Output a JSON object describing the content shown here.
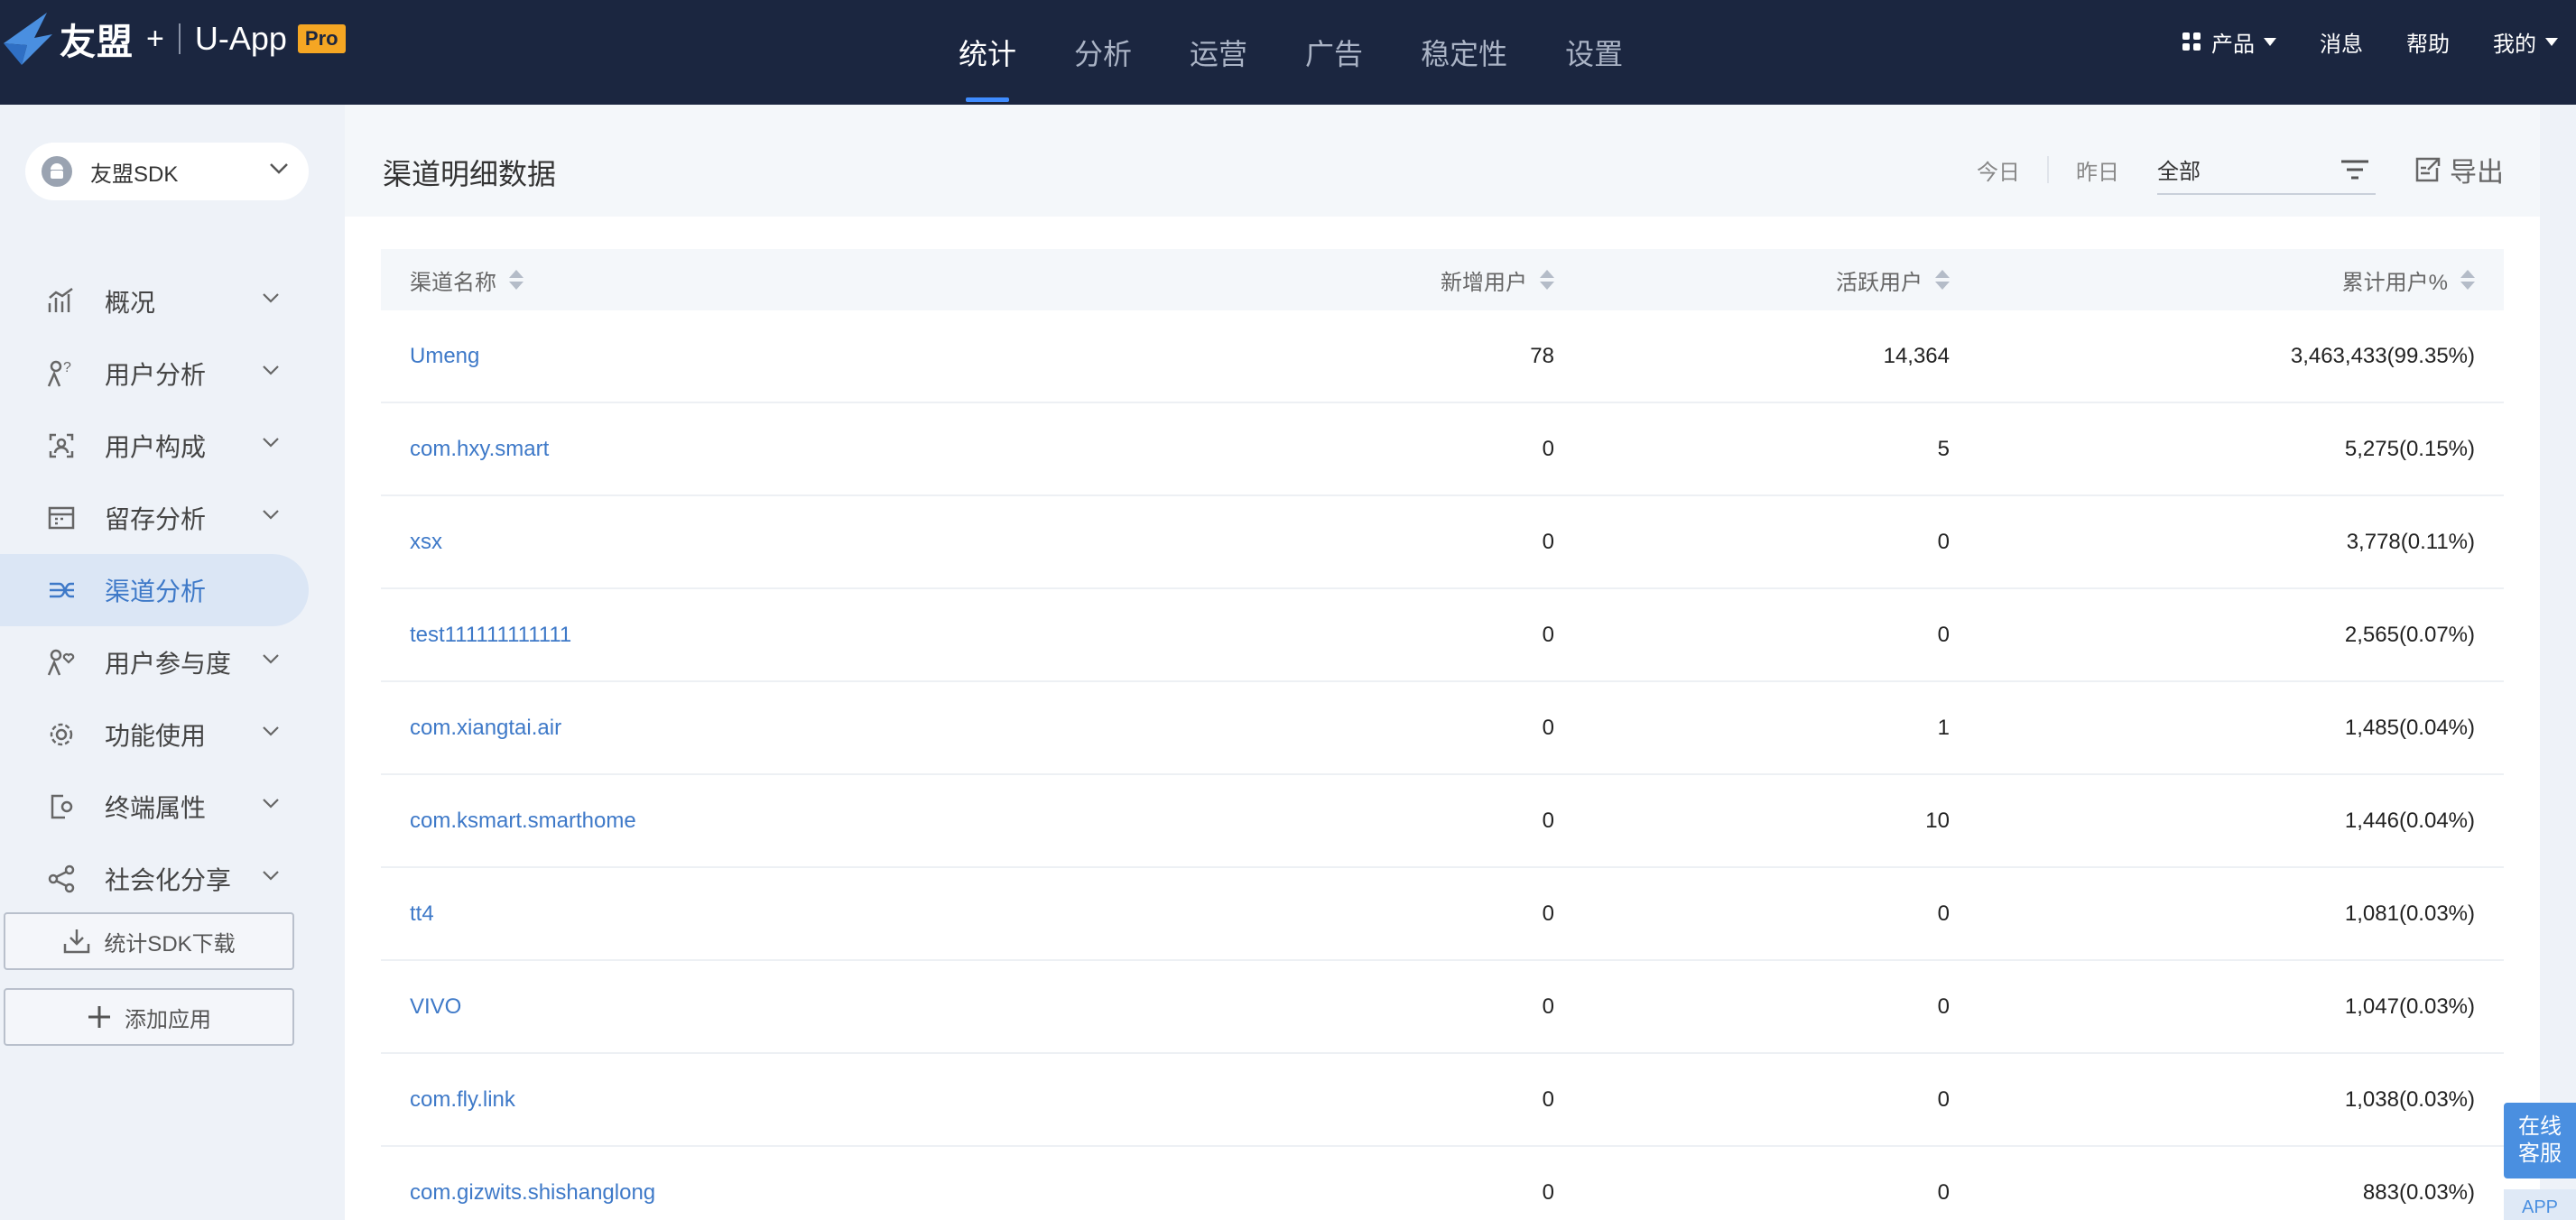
{
  "brand": {
    "name": "友盟",
    "plus": "+",
    "product": "U-App",
    "badge": "Pro"
  },
  "topnav": [
    {
      "label": "统计",
      "active": true
    },
    {
      "label": "分析",
      "active": false
    },
    {
      "label": "运营",
      "active": false
    },
    {
      "label": "广告",
      "active": false
    },
    {
      "label": "稳定性",
      "active": false
    },
    {
      "label": "设置",
      "active": false
    }
  ],
  "topright": {
    "products": "产品",
    "messages": "消息",
    "help": "帮助",
    "mine": "我的"
  },
  "sidebar": {
    "app_name": "友盟SDK",
    "items": [
      {
        "label": "概况",
        "icon": "chart-line-icon",
        "active": false
      },
      {
        "label": "用户分析",
        "icon": "user-question-icon",
        "active": false
      },
      {
        "label": "用户构成",
        "icon": "user-frame-icon",
        "active": false
      },
      {
        "label": "留存分析",
        "icon": "retention-grid-icon",
        "active": false
      },
      {
        "label": "渠道分析",
        "icon": "channel-flow-icon",
        "active": true
      },
      {
        "label": "用户参与度",
        "icon": "user-heart-icon",
        "active": false
      },
      {
        "label": "功能使用",
        "icon": "gear-icon",
        "active": false
      },
      {
        "label": "终端属性",
        "icon": "device-gear-icon",
        "active": false
      },
      {
        "label": "社会化分享",
        "icon": "share-icon",
        "active": false
      }
    ],
    "sdk_download": "统计SDK下载",
    "add_app": "添加应用"
  },
  "panel": {
    "title": "渠道明细数据",
    "today": "今日",
    "yesterday": "昨日",
    "filter_value": "全部",
    "export": "导出"
  },
  "table": {
    "headers": {
      "name": "渠道名称",
      "new_users": "新增用户",
      "active_users": "活跃用户",
      "total_users": "累计用户%"
    },
    "rows": [
      {
        "name": "Umeng",
        "new_users": "78",
        "active_users": "14,364",
        "total_users": "3,463,433(99.35%)"
      },
      {
        "name": "com.hxy.smart",
        "new_users": "0",
        "active_users": "5",
        "total_users": "5,275(0.15%)"
      },
      {
        "name": "xsx",
        "new_users": "0",
        "active_users": "0",
        "total_users": "3,778(0.11%)"
      },
      {
        "name": "test111111111111",
        "new_users": "0",
        "active_users": "0",
        "total_users": "2,565(0.07%)"
      },
      {
        "name": "com.xiangtai.air",
        "new_users": "0",
        "active_users": "1",
        "total_users": "1,485(0.04%)"
      },
      {
        "name": "com.ksmart.smarthome",
        "new_users": "0",
        "active_users": "10",
        "total_users": "1,446(0.04%)"
      },
      {
        "name": "tt4",
        "new_users": "0",
        "active_users": "0",
        "total_users": "1,081(0.03%)"
      },
      {
        "name": "VIVO",
        "new_users": "0",
        "active_users": "0",
        "total_users": "1,047(0.03%)"
      },
      {
        "name": "com.fly.link",
        "new_users": "0",
        "active_users": "0",
        "total_users": "1,038(0.03%)"
      },
      {
        "name": "com.gizwits.shishanglong",
        "new_users": "0",
        "active_users": "0",
        "total_users": "883(0.03%)"
      }
    ]
  },
  "float": {
    "service_line1": "在线",
    "service_line2": "客服",
    "app": "APP"
  },
  "colors": {
    "topbar": "#1b2640",
    "accent": "#3e79c8",
    "active_nav_underline": "#3f8cff",
    "pro_badge": "#f5a623"
  }
}
